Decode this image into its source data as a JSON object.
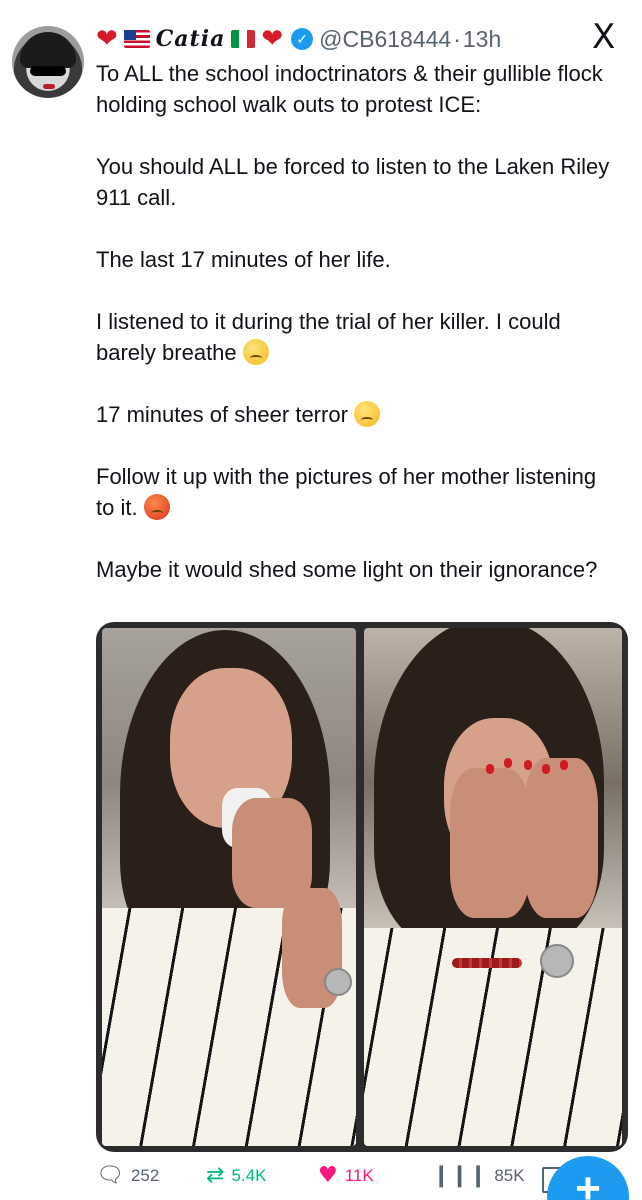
{
  "header": {
    "display_name": "Catia",
    "handle": "@CB618444",
    "separator": "·",
    "time_ago": "13h",
    "verified_check": "✓",
    "x_logo": "X",
    "heart_left": "❤",
    "heart_right": "❤"
  },
  "body": {
    "paragraphs": [
      "To ALL the school indoctrinators & their gullible flock holding school walk outs to protest ICE:",
      "You should ALL be forced to listen to the Laken Riley 911 call.",
      "The last 17 minutes of her life.",
      "I listened to it during the trial of her killer. I could barely breathe",
      "17 minutes of sheer terror",
      "Follow it up with the pictures of her mother listening to it.",
      "Maybe it would shed some light on their ignorance?"
    ],
    "emojis": [
      "disappointed-face-emoji",
      "weary-face-emoji",
      "cursing-face-emoji"
    ]
  },
  "media": {
    "images": [
      "woman-crying-with-tissue-photo",
      "woman-covering-face-with-hands-photo"
    ]
  },
  "actions": {
    "replies": "252",
    "retweets": "5.4K",
    "likes": "11K",
    "views": "85K",
    "compose_label": "+"
  },
  "icons": {
    "reply": "reply-icon",
    "retweet": "retweet-icon",
    "like": "heart-icon",
    "views": "views-icon",
    "bookmark": "bookmark-icon"
  },
  "colors": {
    "accent": "#1d9bf0",
    "retweet": "#00ba7c",
    "like": "#f91880",
    "muted": "#536471",
    "text": "#0f1419"
  }
}
